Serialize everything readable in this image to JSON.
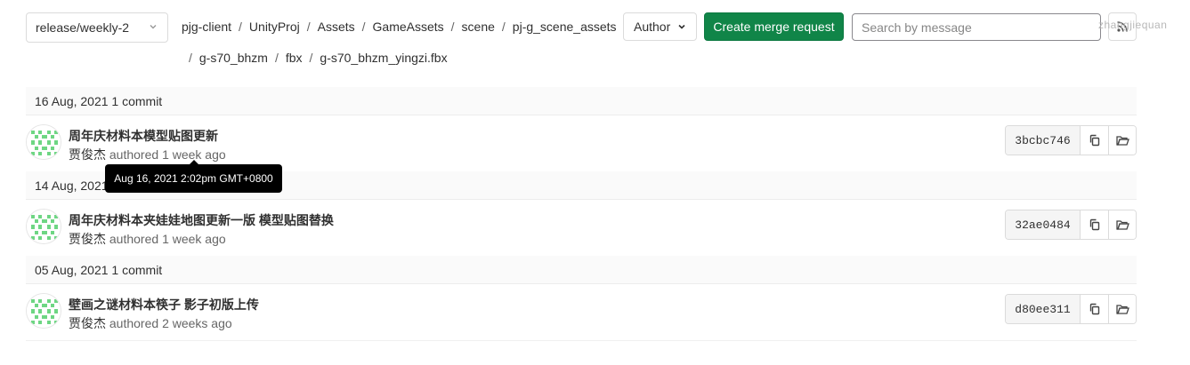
{
  "branch": {
    "name": "release/weekly-2"
  },
  "breadcrumb": {
    "line1": [
      "pjg-client",
      "UnityProj",
      "Assets",
      "GameAssets",
      "scene",
      "pj-g_scene_assets"
    ],
    "line2": [
      "g-s70_bhzm",
      "fbx",
      "g-s70_bhzm_yingzi.fbx"
    ],
    "separator": "/"
  },
  "toolbar": {
    "author_label": "Author",
    "merge_request_label": "Create merge request",
    "search_placeholder": "Search by message",
    "watermark": "zhangjiequan"
  },
  "colors": {
    "primary_green": "#108548",
    "tooltip_bg": "#000000",
    "header_bg": "#fafafa"
  },
  "groups": [
    {
      "date": "16 Aug, 2021 1 commit",
      "commits": [
        {
          "title": "周年庆材料本模型贴图更新",
          "author": "贾俊杰",
          "authored": "authored",
          "time": "1 week ago",
          "sha": "3bcbc746"
        }
      ]
    },
    {
      "date": "14 Aug, 2021 1 commit",
      "commits": [
        {
          "title": "周年庆材料本夹娃娃地图更新一版 模型贴图替换",
          "author": "贾俊杰",
          "authored": "authored",
          "time": "1 week ago",
          "sha": "32ae0484"
        }
      ]
    },
    {
      "date": "05 Aug, 2021 1 commit",
      "commits": [
        {
          "title": "壁画之谜材料本筷子 影子初版上传",
          "author": "贾俊杰",
          "authored": "authored",
          "time": "2 weeks ago",
          "sha": "d80ee311"
        }
      ]
    }
  ],
  "tooltip": {
    "text": "Aug 16, 2021 2:02pm GMT+0800"
  }
}
